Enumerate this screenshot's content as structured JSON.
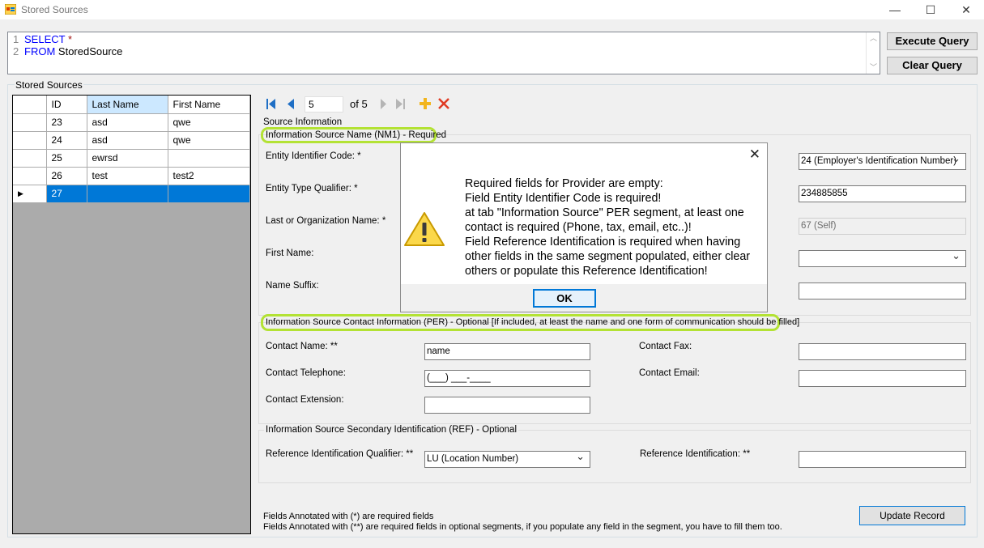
{
  "window": {
    "title": "Stored Sources",
    "minimize_glyph": "—",
    "maximize_glyph": "☐",
    "close_glyph": "✕"
  },
  "query": {
    "line_numbers": [
      "1",
      "2"
    ],
    "line1_keyword": "SELECT",
    "line1_rest": "*",
    "line2_keyword": "FROM",
    "line2_rest": "StoredSource",
    "execute_label": "Execute Query",
    "clear_label": "Clear Query"
  },
  "stored_sources": {
    "group_title": "Stored Sources",
    "columns": [
      "ID",
      "Last Name",
      "First Name"
    ],
    "rows": [
      {
        "id": "23",
        "last": "asd",
        "first": "qwe"
      },
      {
        "id": "24",
        "last": "asd",
        "first": "qwe"
      },
      {
        "id": "25",
        "last": "ewrsd",
        "first": ""
      },
      {
        "id": "26",
        "last": "test",
        "first": "test2"
      },
      {
        "id": "27",
        "last": "",
        "first": ""
      }
    ],
    "current_row_marker": "▶"
  },
  "navigator": {
    "position": "5",
    "of_text": "of 5"
  },
  "source_info": {
    "title": "Source Information",
    "nm1": {
      "title": "Information Source Name (NM1) - Required",
      "entity_id_label": "Entity Identifier Code: *",
      "entity_type_label": "Entity Type Qualifier: *",
      "last_org_label": "Last or Organization Name: *",
      "first_name_label": "First Name:",
      "name_suffix_label": "Name Suffix:",
      "id_code_qualifier_value": "24 (Employer's Identification Number)",
      "id_code_value": "234885855",
      "relationship_value": "67 (Self)",
      "first_combo_value": "",
      "suffix_value": ""
    },
    "per": {
      "title": "Information Source Contact Information (PER) - Optional [If included, at least the name and one form of communication should be filled]",
      "contact_name_label": "Contact Name: **",
      "contact_name_value": "name",
      "contact_phone_label": "Contact Telephone:",
      "contact_phone_value": "(___) ___-____",
      "contact_ext_label": "Contact Extension:",
      "contact_ext_value": "",
      "contact_fax_label": "Contact Fax:",
      "contact_fax_value": "",
      "contact_email_label": "Contact Email:",
      "contact_email_value": ""
    },
    "ref": {
      "title": "Information Source Secondary Identification (REF) - Optional",
      "ref_qualifier_label": "Reference Identification Qualifier: **",
      "ref_qualifier_value": "LU (Location Number)",
      "ref_id_label": "Reference Identification: **",
      "ref_id_value": ""
    },
    "notes": [
      "Fields Annotated with (*) are required fields",
      "Fields Annotated with (**) are required fields in optional segments, if you populate any field in the segment, you have to fill them too."
    ],
    "update_label": "Update Record"
  },
  "dialog": {
    "message": "Required fields for Provider are empty:\nField Entity Identifier Code is required!\nat tab \"Information Source\" PER segment, at least one contact is required (Phone, tax, email, etc..)!\nField Reference Identification is required when having other fields in the same segment populated, either clear others or populate this Reference Identification!",
    "ok_label": "OK",
    "close_glyph": "✕",
    "icon": "warning-icon"
  },
  "colors": {
    "highlight": "#b3e234",
    "selection": "#0078d7",
    "keyword": "#0000ff"
  }
}
